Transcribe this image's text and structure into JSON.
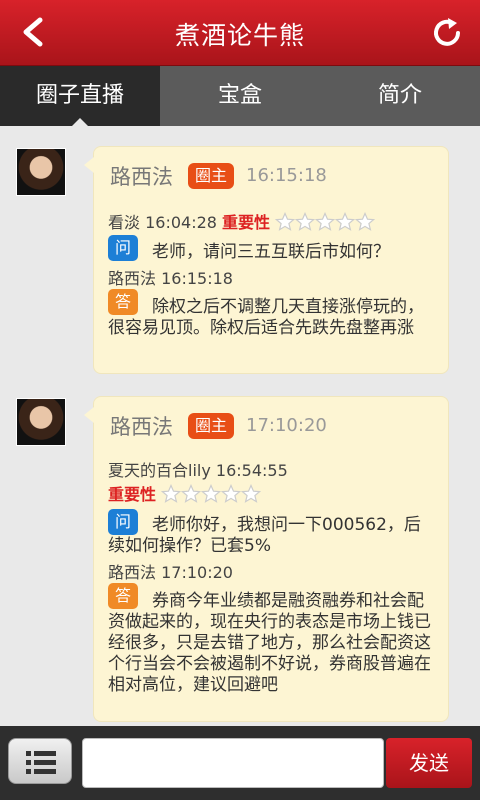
{
  "header": {
    "title": "煮酒论牛熊",
    "back_icon": "back-icon",
    "refresh_icon": "refresh-icon"
  },
  "tabs": [
    {
      "label": "圈子直播",
      "active": true
    },
    {
      "label": "宝盒",
      "active": false
    },
    {
      "label": "简介",
      "active": false
    }
  ],
  "posts": [
    {
      "author": "路西法",
      "badge": "圈主",
      "time": "16:15:18",
      "asker": "看淡 16:04:28",
      "importance_label": "重要性",
      "importance_stars": 0,
      "question_icon": "问",
      "question": "老师，请问三五互联后市如何？",
      "answerer": "路西法 16:15:18",
      "answer_icon": "答",
      "answer": "除权之后不调整几天直接涨停玩的，很容易见顶。除权后适合先跌先盘整再涨"
    },
    {
      "author": "路西法",
      "badge": "圈主",
      "time": "17:10:20",
      "asker": "夏天的百合lily 16:54:55",
      "importance_label": "重要性",
      "importance_stars": 0,
      "question_icon": "问",
      "question": "老师你好，我想问一下000562，后续如何操作？已套5%",
      "answerer": "路西法 17:10:20",
      "answer_icon": "答",
      "answer": "券商今年业绩都是融资融券和社会配资做起来的，现在央行的表态是市场上钱已经很多，只是去错了地方，那么社会配资这个行当会不会被遏制不好说，券商股普遍在相对高位，建议回避吧"
    }
  ],
  "footer": {
    "input_placeholder": "",
    "send_label": "发送",
    "menu_icon": "list-icon"
  },
  "colors": {
    "brand_red": "#c41a21",
    "card_bg": "#fdf5d3",
    "badge": "#e84e16",
    "question": "#1d7fd6",
    "answer": "#f08a26"
  }
}
